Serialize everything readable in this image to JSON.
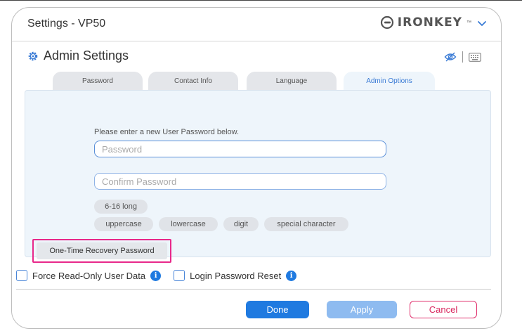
{
  "window": {
    "title": "Settings - VP50"
  },
  "brand": {
    "name": "IRONKEY",
    "tm": "™"
  },
  "section": {
    "title": "Admin Settings"
  },
  "tabs": [
    {
      "label": "Password",
      "active": false
    },
    {
      "label": "Contact Info",
      "active": false
    },
    {
      "label": "Language",
      "active": false
    },
    {
      "label": "Admin Options",
      "active": true
    }
  ],
  "form": {
    "hint": "Please enter a new User Password below.",
    "password_placeholder": "Password",
    "confirm_placeholder": "Confirm Password"
  },
  "requirements": [
    "6-16 long",
    "uppercase",
    "lowercase",
    "digit",
    "special character"
  ],
  "otrp_button": "One-Time Recovery Password",
  "checkboxes": [
    {
      "label": "Force Read-Only User Data",
      "checked": false
    },
    {
      "label": "Login Password Reset",
      "checked": false
    }
  ],
  "buttons": {
    "done": "Done",
    "apply": "Apply",
    "cancel": "Cancel"
  },
  "colors": {
    "accent": "#1f7ae0",
    "highlight": "#e8288a",
    "cancel": "#e0306d"
  },
  "icons": {
    "section": "gear-icon",
    "visibility": "eye-off-icon",
    "keyboard": "keyboard-icon",
    "menu": "chevron-down-icon",
    "info": "info-icon"
  }
}
